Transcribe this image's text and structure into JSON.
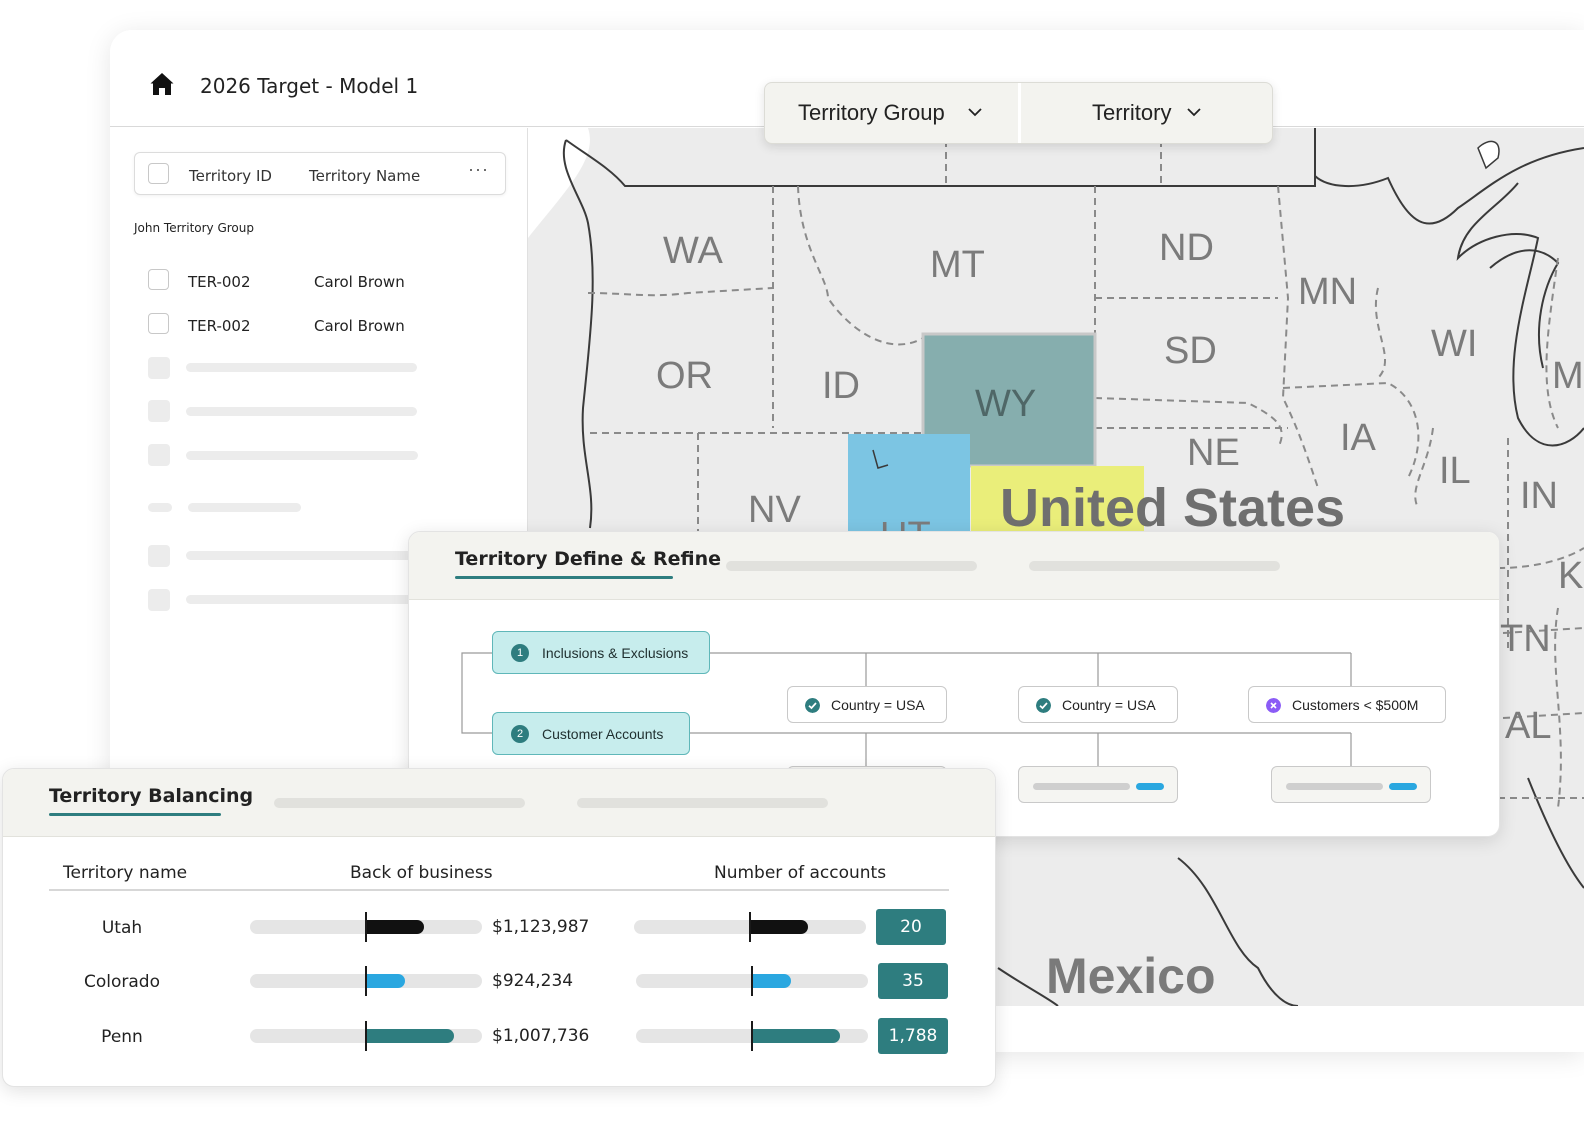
{
  "app": {
    "title": "2026 Target - Model 1"
  },
  "selector": {
    "group_label": "Territory Group",
    "territory_label": "Territory"
  },
  "table": {
    "col_id": "Territory ID",
    "col_name": "Territory Name",
    "more": "···",
    "group_label": "John Territory Group",
    "rows": [
      {
        "id": "TER-002",
        "name": "Carol Brown"
      },
      {
        "id": "TER-002",
        "name": "Carol Brown"
      }
    ]
  },
  "map": {
    "states": [
      "WA",
      "MT",
      "ND",
      "MN",
      "OR",
      "ID",
      "SD",
      "WI",
      "WY",
      "IA",
      "NE",
      "IL",
      "NV",
      "IN",
      "UT",
      "TN",
      "AL",
      "M",
      "K"
    ],
    "country_label": "United States",
    "mexico_label": "Mexico",
    "highlight_colors": {
      "WY": "#86aeae",
      "UT": "#7cc5e3",
      "CO": "#eaee7a"
    }
  },
  "define": {
    "tab_active": "Territory Define & Refine",
    "steps": [
      {
        "num": "1",
        "label": "Inclusions & Exclusions"
      },
      {
        "num": "2",
        "label": "Customer Accounts"
      }
    ],
    "conditions": [
      {
        "label": "Country = USA",
        "status": "check",
        "color": "#2e7d7f"
      },
      {
        "label": "Country = USA",
        "status": "check",
        "color": "#2e7d7f"
      },
      {
        "label": "Customers < $500M",
        "status": "exclude",
        "color": "#8b5cf6"
      }
    ]
  },
  "balancing": {
    "tab_active": "Territory Balancing",
    "col_name": "Territory name",
    "col_bob": "Back of business",
    "col_accounts": "Number of accounts",
    "rows": [
      {
        "name": "Utah",
        "bob_value": "$1,123,987",
        "bob_fraction": 0.25,
        "bob_color": "#111111",
        "accounts": "20",
        "acc_fraction": 0.25,
        "acc_color": "#111111"
      },
      {
        "name": "Colorado",
        "bob_value": "$924,234",
        "bob_fraction": 0.17,
        "bob_color": "#2aa7e0",
        "accounts": "35",
        "acc_fraction": 0.17,
        "acc_color": "#2aa7e0"
      },
      {
        "name": "Penn",
        "bob_value": "$1,007,736",
        "bob_fraction": 0.38,
        "bob_color": "#2e7d7f",
        "accounts": "1,788",
        "acc_fraction": 0.38,
        "acc_color": "#2e7d7f"
      }
    ]
  },
  "colors": {
    "accent": "#2e7d7f",
    "accent_light": "#c7eded",
    "blue": "#2aa7e0"
  }
}
